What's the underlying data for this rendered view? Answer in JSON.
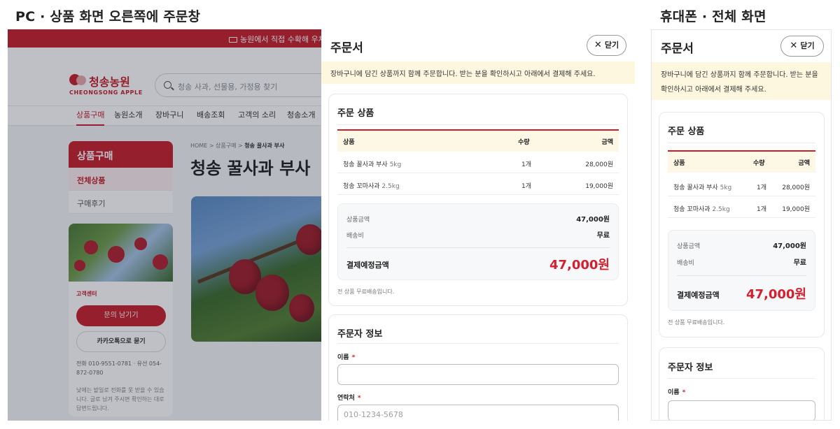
{
  "captions": {
    "left": "PC · 상품 화면 오른쪽에 주문창",
    "right": "휴대폰 · 전체 화면"
  },
  "shop": {
    "banner": "농원에서 직접 수확해 우체국 택",
    "logo_kr": "청송농원",
    "logo_en": "CHEONGSONG APPLE",
    "search_placeholder": "청송 사과, 선물용, 가정용 찾기",
    "nav": [
      "상품구매",
      "농원소개",
      "장바구니",
      "배송조회",
      "고객의 소리",
      "청송소개"
    ],
    "side_head": "상품구매",
    "side_items": [
      "전체상품",
      "구매후기"
    ],
    "cs_label": "고객센터",
    "cs_btn1": "문의 남기기",
    "cs_btn2": "카카오톡으로 묻기",
    "cs_tel": "전화 010-9551-0781 · 유선 054-872-0780",
    "cs_note": "낮에는 밭일로 전화를 못 받을 수 있습니다. 글로 남겨 주시면 확인하는 대로 답변드립니다.",
    "crumb_prefix": "HOME > 상품구매 > ",
    "crumb_current": "청송 꿀사과 부사",
    "title": "청송 꿀사과 부사"
  },
  "order": {
    "title": "주문서",
    "close_label": "닫기",
    "notice": "장바구니에 담긴 상품까지 함께 주문합니다. 받는 분을 확인하시고 아래에서 결제해 주세요.",
    "items_title": "주문 상품",
    "columns": {
      "product": "상품",
      "qty": "수량",
      "price": "금액"
    },
    "rows": [
      {
        "name": "청송 꿀사과 부사",
        "option": "5kg",
        "qty": "1개",
        "price": "28,000원"
      },
      {
        "name": "청송 꼬마사과",
        "option": "2.5kg",
        "qty": "1개",
        "price": "19,000원"
      }
    ],
    "summary": {
      "subtotal_label": "상품금액",
      "subtotal": "47,000원",
      "shipping_label": "배송비",
      "shipping": "무료",
      "total_label": "결제예정금액",
      "total": "47,000원"
    },
    "free_note": "전 상품 무료배송입니다.",
    "orderer_title": "주문자 정보",
    "fields": {
      "name_label": "이름",
      "phone_label": "연락처",
      "phone_placeholder": "010-1234-5678"
    }
  },
  "colors": {
    "accent": "#c8202b",
    "total": "#d4202e",
    "notice_bg": "#fdf7df"
  }
}
